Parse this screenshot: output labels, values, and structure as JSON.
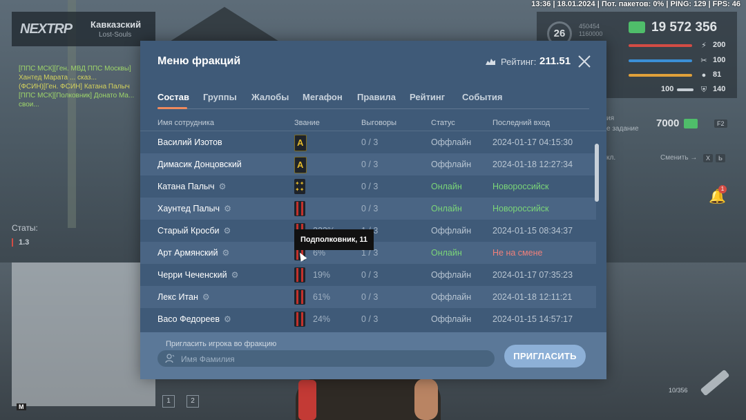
{
  "hud": {
    "top_info": "13:36 | 18.01.2024 | Пот. пакетов: 0% | PING: 129 | FPS: 46",
    "logo": "NEXTRP",
    "server_name": "Кавказский",
    "server_sub": "Lost-Souls",
    "chat": [
      "[ППС МСК][Ген. МВД ППС Москвы]",
      "Хантед Марата ... сказ...",
      "(ФСИН)[Ген. ФСИН] Катана Палыч",
      "[ППС МСК][Полковник] Донато Ма...",
      "свои..."
    ],
    "stats_label": "Статы:",
    "stats_value": "1.3",
    "level": "26",
    "xp": "450454\n1160000",
    "money": "19 572 356",
    "bars": [
      {
        "value": "200",
        "color": "#d34c44"
      },
      {
        "value": "100",
        "color": "#3b8fd6"
      },
      {
        "value": "81",
        "color": "#e0a03a"
      },
      {
        "value": "140",
        "color": "#c5ccd3"
      }
    ],
    "bar_100": "100",
    "side_quest_1": "ия",
    "side_quest_2": "е задание",
    "side_price": "7000",
    "side_key_f2": "F2",
    "side_key_x": "X",
    "side_key_b": "Ь",
    "side_kl": "кл.",
    "side_switch": "Сменить →",
    "bell_badge": "1",
    "ammo": "10/356",
    "minimap_key": "M",
    "slot_1": "1",
    "slot_2": "2"
  },
  "modal": {
    "title": "Меню фракций",
    "rating_label": "Рейтинг:",
    "rating_value": "211.51",
    "tabs": [
      "Состав",
      "Группы",
      "Жалобы",
      "Мегафон",
      "Правила",
      "Рейтинг",
      "События"
    ],
    "active_tab": "Состав",
    "columns": {
      "name": "Имя сотрудника",
      "rank": "Звание",
      "warnings": "Выговоры",
      "status": "Статус",
      "last_login": "Последний вход"
    },
    "rows": [
      {
        "name": "Василий Изотов",
        "gear": false,
        "rank_icon": "gold-a",
        "pct": "",
        "warnings": "0 / 3",
        "status": "Оффлайн",
        "last": "2024-01-17 04:15:30",
        "last_type": "date"
      },
      {
        "name": "Димасик Донцовский",
        "gear": false,
        "rank_icon": "gold-a",
        "pct": "",
        "warnings": "0 / 3",
        "status": "Оффлайн",
        "last": "2024-01-18 12:27:34",
        "last_type": "date"
      },
      {
        "name": "Катана Палыч",
        "gear": true,
        "rank_icon": "stars",
        "pct": "",
        "warnings": "0 / 3",
        "status": "Онлайн",
        "last": "Новороссийск",
        "last_type": "city"
      },
      {
        "name": "Хаунтед Палыч",
        "gear": true,
        "rank_icon": "red",
        "pct": "",
        "warnings": "0 / 3",
        "status": "Онлайн",
        "last": "Новороссийск",
        "last_type": "city"
      },
      {
        "name": "Старый Кросби",
        "gear": true,
        "rank_icon": "red",
        "pct": "233%",
        "warnings": "1 / 3",
        "status": "Оффлайн",
        "last": "2024-01-15 08:34:37",
        "last_type": "date"
      },
      {
        "name": "Арт Армянский",
        "gear": true,
        "rank_icon": "red",
        "pct": "6%",
        "warnings": "1 / 3",
        "status": "Онлайн",
        "last": "Не на смене",
        "last_type": "notshift"
      },
      {
        "name": "Черри Чеченский",
        "gear": true,
        "rank_icon": "red",
        "pct": "19%",
        "warnings": "0 / 3",
        "status": "Оффлайн",
        "last": "2024-01-17 07:35:23",
        "last_type": "date"
      },
      {
        "name": "Лекс Итан",
        "gear": true,
        "rank_icon": "red",
        "pct": "61%",
        "warnings": "0 / 3",
        "status": "Оффлайн",
        "last": "2024-01-18 12:11:21",
        "last_type": "date"
      },
      {
        "name": "Васо Федореев",
        "gear": true,
        "rank_icon": "red",
        "pct": "24%",
        "warnings": "0 / 3",
        "status": "Оффлайн",
        "last": "2024-01-15 14:57:17",
        "last_type": "date"
      }
    ],
    "tooltip": "Подполковник, 11",
    "invite": {
      "label": "Пригласить игрока во фракцию",
      "placeholder": "Имя Фамилия",
      "value": "",
      "button": "ПРИГЛАСИТЬ"
    }
  }
}
